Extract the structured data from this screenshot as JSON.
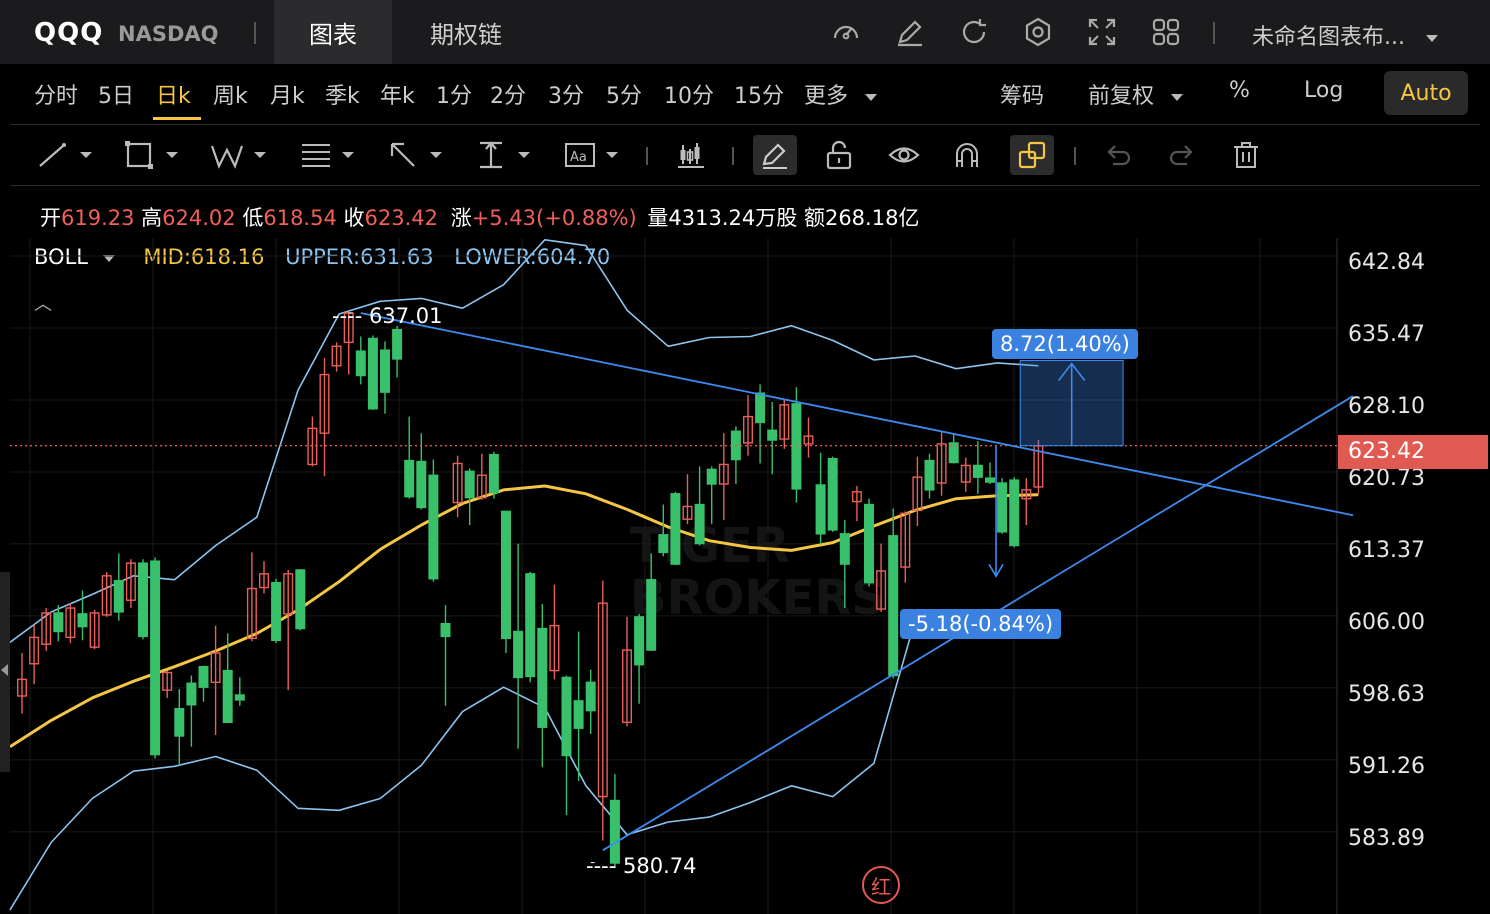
{
  "header": {
    "symbol": "QQQ",
    "exchange": "NASDAQ",
    "tabs": [
      "图表",
      "期权链"
    ],
    "active_tab": "图表",
    "icons": [
      "gauge-icon",
      "edit-icon",
      "refresh-icon",
      "settings-icon",
      "fullscreen-icon",
      "layout-grid-icon"
    ],
    "layout_name": "未命名图表布..."
  },
  "periods": [
    "分时",
    "5日",
    "日k",
    "周k",
    "月k",
    "季k",
    "年k",
    "1分",
    "2分",
    "3分",
    "5分",
    "10分",
    "15分",
    "更多"
  ],
  "active_period": "日k",
  "right_controls": {
    "chips": "筹码",
    "adjust": "前复权",
    "percent": "%",
    "log": "Log",
    "auto": "Auto"
  },
  "ohlc": {
    "open_label": "开",
    "open": "619.23",
    "high_label": "高",
    "high": "624.02",
    "low_label": "低",
    "low": "618.54",
    "close_label": "收",
    "close": "623.42",
    "change_label": "涨",
    "change": "+5.43(+0.88%)",
    "volume_label": "量",
    "volume": "4313.24万股",
    "amount_label": "额",
    "amount": "268.18亿"
  },
  "indicator": {
    "name": "BOLL",
    "mid_label": "MID:",
    "mid": "618.16",
    "upper_label": "UPPER:",
    "upper": "631.63",
    "lower_label": "LOWER:",
    "lower": "604.70",
    "colors": {
      "mid": "#f4c644",
      "upper": "#8cc4f0",
      "lower": "#8cc4f0"
    }
  },
  "price_axis": [
    "642.84",
    "635.47",
    "628.10",
    "620.73",
    "613.37",
    "606.00",
    "598.63",
    "591.26",
    "583.89"
  ],
  "current_price": "623.42",
  "annotations": {
    "high_marker": "637.01",
    "low_marker": "580.74",
    "up_measure": "8.72(1.40%)",
    "down_measure": "-5.18(-0.84%)"
  },
  "watermark": [
    "TIGER",
    "BROKERS"
  ],
  "red_badge": "红",
  "colors": {
    "up": "#e8605a",
    "down": "#39c06a",
    "mid": "#f4c644",
    "band": "#8cc4f0",
    "trend": "#3d8bf0",
    "accent": "#f4c644"
  },
  "chart_data": {
    "type": "candlestick",
    "ylim": [
      580,
      645
    ],
    "y_ticks": [
      642.84,
      635.47,
      628.1,
      620.73,
      613.37,
      606.0,
      598.63,
      591.26,
      583.89
    ],
    "candles": [
      [
        597.8,
        599.5,
        596.0,
        602.2
      ],
      [
        601.1,
        603.8,
        599.0,
        605.1
      ],
      [
        603.1,
        606.3,
        602.4,
        606.8
      ],
      [
        606.3,
        604.4,
        603.4,
        607.1
      ],
      [
        603.8,
        606.8,
        603.2,
        607.3
      ],
      [
        606.2,
        604.9,
        603.5,
        608.6
      ],
      [
        602.8,
        606.3,
        602.6,
        606.6
      ],
      [
        606.1,
        610.1,
        605.9,
        610.5
      ],
      [
        609.6,
        606.4,
        605.5,
        612.4
      ],
      [
        607.6,
        611.4,
        606.8,
        611.8
      ],
      [
        611.4,
        603.9,
        603.6,
        611.8
      ],
      [
        611.6,
        591.8,
        591.4,
        612.0
      ],
      [
        598.4,
        600.2,
        597.6,
        600.4
      ],
      [
        596.5,
        593.7,
        590.6,
        598.5
      ],
      [
        599.1,
        596.9,
        592.6,
        599.9
      ],
      [
        600.8,
        598.7,
        597.2,
        600.9
      ],
      [
        599.2,
        602.2,
        593.8,
        605.0
      ],
      [
        600.4,
        595.1,
        595.1,
        604.2
      ],
      [
        597.9,
        597.4,
        596.8,
        599.7
      ],
      [
        603.7,
        608.8,
        603.4,
        612.5
      ],
      [
        608.9,
        610.3,
        608.3,
        611.6
      ],
      [
        609.4,
        603.5,
        603.2,
        609.8
      ],
      [
        606.2,
        610.3,
        598.4,
        610.7
      ],
      [
        610.7,
        604.7,
        604.5,
        610.8
      ],
      [
        621.5,
        625.2,
        621.3,
        626.4
      ],
      [
        624.7,
        630.7,
        620.3,
        632.4
      ],
      [
        631.6,
        633.6,
        631.0,
        634.0
      ],
      [
        634.0,
        637.0,
        630.7,
        637.2
      ],
      [
        633.1,
        630.6,
        629.7,
        634.6
      ],
      [
        634.4,
        627.2,
        627.1,
        634.7
      ],
      [
        633.2,
        628.9,
        626.7,
        634.1
      ],
      [
        635.3,
        632.3,
        630.4,
        635.7
      ],
      [
        621.9,
        618.2,
        618.0,
        626.4
      ],
      [
        621.8,
        617.1,
        616.9,
        624.7
      ],
      [
        620.4,
        609.8,
        609.5,
        622.0
      ],
      [
        605.2,
        603.9,
        596.8,
        607.1
      ],
      [
        617.6,
        621.6,
        616.1,
        622.4
      ],
      [
        620.8,
        618.1,
        615.3,
        621.1
      ],
      [
        618.1,
        620.4,
        617.9,
        622.6
      ],
      [
        622.5,
        618.6,
        618.0,
        622.8
      ],
      [
        616.7,
        603.7,
        602.2,
        616.7
      ],
      [
        604.4,
        599.7,
        592.4,
        613.4
      ],
      [
        610.3,
        599.8,
        599.2,
        610.5
      ],
      [
        604.7,
        594.6,
        590.5,
        607.2
      ],
      [
        600.4,
        605.0,
        599.5,
        609.2
      ],
      [
        599.7,
        591.7,
        585.6,
        599.9
      ],
      [
        597.3,
        594.5,
        589.1,
        604.4
      ],
      [
        599.2,
        596.3,
        593.9,
        600.5
      ],
      [
        587.5,
        607.3,
        583.0,
        609.6
      ],
      [
        587.1,
        580.7,
        580.2,
        589.8
      ],
      [
        595.1,
        602.5,
        594.7,
        605.9
      ],
      [
        605.9,
        601.0,
        597.0,
        606.2
      ],
      [
        609.7,
        602.5,
        602.4,
        612.4
      ],
      [
        614.3,
        612.5,
        612.1,
        617.4
      ],
      [
        618.5,
        611.3,
        611.2,
        618.7
      ],
      [
        615.9,
        617.2,
        615.4,
        620.5
      ],
      [
        617.4,
        613.4,
        613.2,
        621.3
      ],
      [
        621.0,
        619.5,
        615.4,
        621.3
      ],
      [
        619.5,
        621.5,
        615.8,
        624.7
      ],
      [
        624.9,
        622.0,
        619.5,
        625.4
      ],
      [
        623.7,
        626.4,
        622.4,
        628.6
      ],
      [
        628.8,
        625.8,
        621.6,
        629.7
      ],
      [
        625.0,
        624.0,
        620.5,
        627.9
      ],
      [
        624.1,
        627.6,
        623.1,
        628.1
      ],
      [
        627.7,
        619.0,
        617.6,
        629.4
      ],
      [
        623.6,
        624.4,
        622.2,
        626.3
      ],
      [
        619.4,
        614.4,
        613.3,
        622.7
      ],
      [
        622.1,
        614.8,
        614.6,
        622.3
      ],
      [
        614.4,
        611.3,
        606.8,
        615.8
      ],
      [
        617.7,
        618.7,
        615.7,
        619.3
      ],
      [
        617.4,
        609.4,
        609.0,
        618.0
      ],
      [
        606.7,
        610.6,
        606.4,
        613.4
      ],
      [
        614.2,
        599.9,
        599.6,
        617.0
      ],
      [
        611.0,
        616.5,
        609.4,
        616.7
      ],
      [
        616.8,
        620.2,
        615.2,
        622.3
      ],
      [
        621.9,
        618.9,
        618.0,
        622.6
      ],
      [
        619.6,
        623.6,
        618.3,
        624.8
      ],
      [
        623.7,
        621.7,
        621.6,
        624.7
      ],
      [
        619.7,
        621.4,
        618.7,
        622.2
      ],
      [
        621.4,
        620.2,
        618.5,
        623.9
      ],
      [
        620.1,
        619.7,
        619.5,
        621.7
      ],
      [
        619.6,
        614.6,
        614.4,
        620.1
      ],
      [
        619.9,
        613.2,
        613.0,
        620.2
      ],
      [
        618.0,
        618.9,
        615.3,
        620.1
      ],
      [
        619.2,
        623.4,
        618.5,
        624.0
      ]
    ],
    "boll_mid": [
      592.6,
      595.3,
      597.6,
      599.3,
      600.8,
      602.4,
      604.2,
      606.6,
      609.5,
      612.8,
      615.3,
      617.5,
      618.9,
      619.3,
      618.5,
      616.9,
      615.1,
      613.7,
      613.0,
      612.7,
      613.5,
      615.2,
      616.8,
      618.0,
      618.3,
      618.4
    ],
    "boll_upper": [
      603.3,
      606.4,
      608.2,
      610.1,
      609.7,
      613.2,
      616.1,
      629.1,
      636.9,
      638.2,
      638.5,
      637.5,
      639.9,
      644.5,
      643.9,
      637.3,
      633.6,
      634.5,
      634.6,
      635.7,
      634.2,
      632.2,
      632.6,
      631.3,
      631.9,
      631.6
    ],
    "boll_lower": [
      575.9,
      582.8,
      587.3,
      590.1,
      590.6,
      591.6,
      590.2,
      586.3,
      586.1,
      587.3,
      590.7,
      596.2,
      598.7,
      596.6,
      588.6,
      583.6,
      584.9,
      585.4,
      586.9,
      588.6,
      587.5,
      590.9,
      605.5,
      604.9,
      604.8,
      604.7
    ],
    "current_price": 623.42,
    "high_marker": 637.01,
    "low_marker": 580.74,
    "trend_lines": [
      {
        "from": [
          637.0,
          28
        ],
        "to": [
          616.3,
          110
        ]
      },
      {
        "from": [
          582.0,
          48
        ],
        "to": [
          628.5,
          110
        ]
      }
    ],
    "measure_up": {
      "from": 623.42,
      "to": 632.14,
      "label": "8.72(1.40%)"
    },
    "measure_down": {
      "from": 623.42,
      "to": 618.24,
      "label": "-5.18(-0.84%)"
    }
  }
}
